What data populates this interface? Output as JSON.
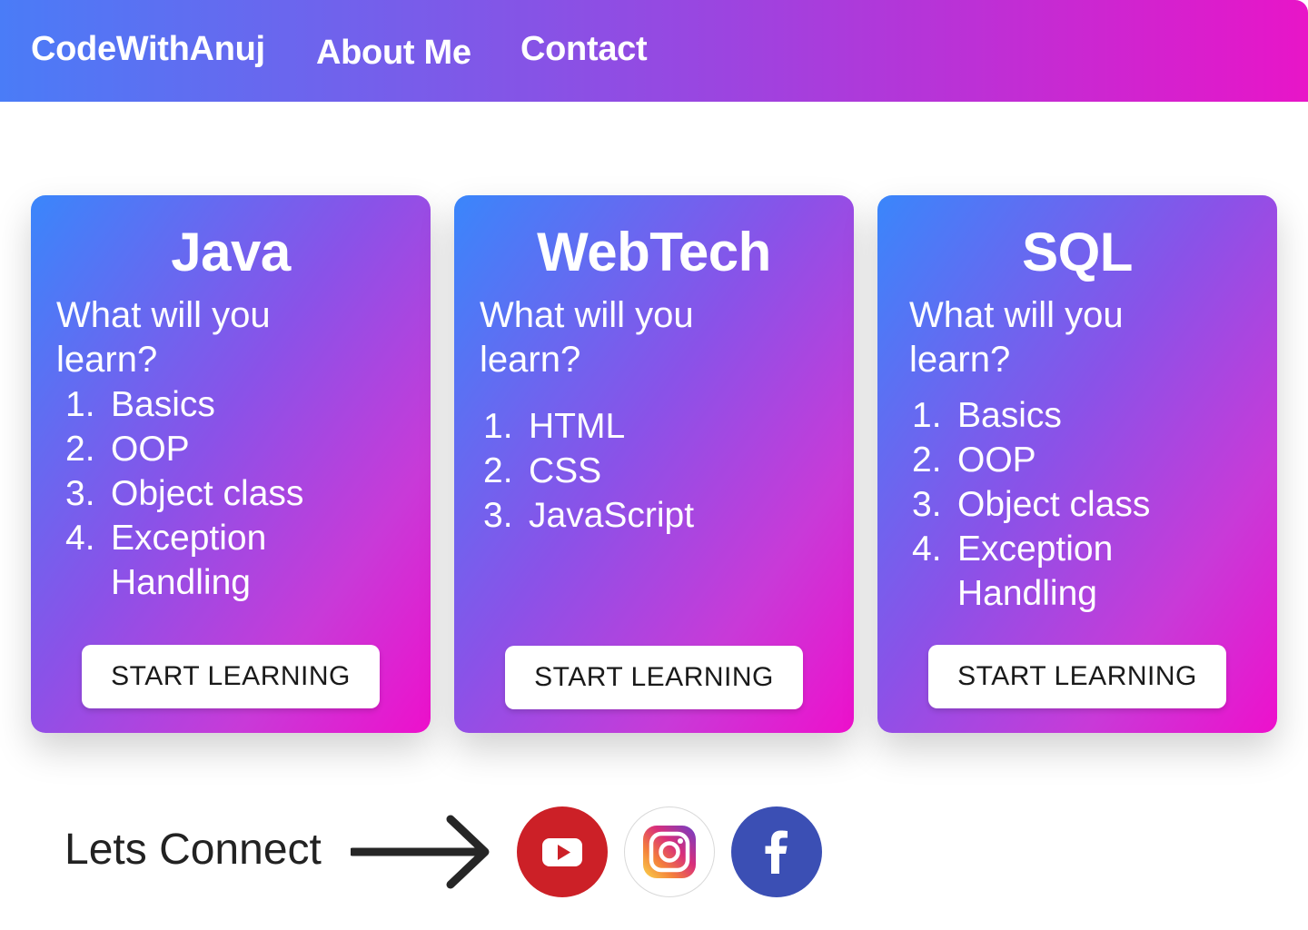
{
  "nav": {
    "brand": "CodeWithAnuj",
    "about": "About Me",
    "contact": "Contact",
    "gradient": [
      "#4a7cf7",
      "#9b45e0",
      "#e815c8"
    ]
  },
  "cards": [
    {
      "title": "Java",
      "subtitle": "What will you learn?",
      "topics": [
        {
          "num": "1.",
          "text": "Basics"
        },
        {
          "num": "2.",
          "text": "OOP"
        },
        {
          "num": "3.",
          "text": "Object class"
        },
        {
          "num": "4.",
          "text": "Exception Handling"
        }
      ],
      "button": "START LEARNING"
    },
    {
      "title": "WebTech",
      "subtitle": "What will you learn?",
      "topics": [
        {
          "num": "1.",
          "text": "HTML"
        },
        {
          "num": "2.",
          "text": "CSS"
        },
        {
          "num": "3.",
          "text": "JavaScript"
        }
      ],
      "button": "START LEARNING"
    },
    {
      "title": "SQL",
      "subtitle": "What will you learn?",
      "topics": [
        {
          "num": "1.",
          "text": "Basics"
        },
        {
          "num": "2.",
          "text": "OOP"
        },
        {
          "num": "3.",
          "text": "Object class"
        },
        {
          "num": "4.",
          "text": "Exception Handling"
        }
      ],
      "button": "START LEARNING"
    }
  ],
  "connect": {
    "label": "Lets Connect",
    "icons": [
      "arrow-right-icon",
      "youtube-icon",
      "instagram-icon",
      "facebook-icon"
    ],
    "colors": {
      "youtube": "#cc2027",
      "facebook": "#3b4fb4"
    }
  }
}
